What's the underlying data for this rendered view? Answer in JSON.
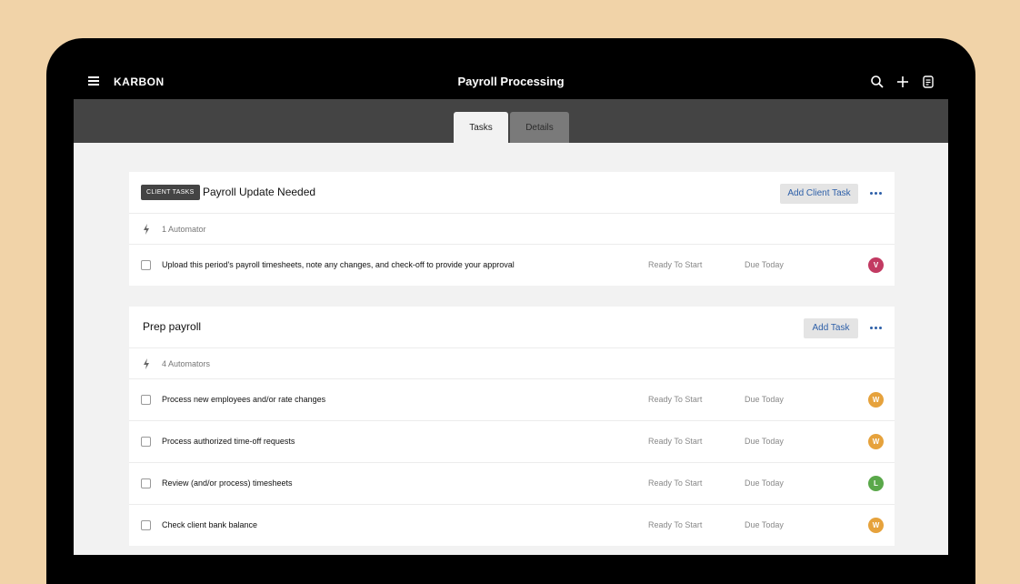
{
  "app": {
    "brand": "KARBON",
    "title": "Payroll Processing"
  },
  "tabs": [
    {
      "label": "Tasks",
      "active": true
    },
    {
      "label": "Details",
      "active": false
    }
  ],
  "icons": {
    "menu": "hamburger-menu-icon",
    "search": "search-icon",
    "add": "plus-icon",
    "notes": "notes-icon",
    "automator": "lightning-bolt-icon",
    "more": "more-dots-icon"
  },
  "colors": {
    "accent": "#2d5fa8",
    "avatar_v": "#c23a62",
    "avatar_w": "#e6a23c",
    "avatar_l": "#5aa84a"
  },
  "client_section": {
    "badge": "CLIENT TASKS",
    "title": "Payroll Update Needed",
    "add_label": "Add Client Task",
    "automators": "1 Automator",
    "tasks": [
      {
        "text": "Upload this period's payroll timesheets, note any changes, and check-off to provide your approval",
        "status": "Ready To Start",
        "due": "Due Today",
        "assignee": "V"
      }
    ]
  },
  "prep_section": {
    "title": "Prep payroll",
    "add_label": "Add Task",
    "automators": "4 Automators",
    "tasks": [
      {
        "text": "Process new employees and/or rate changes",
        "status": "Ready To Start",
        "due": "Due Today",
        "assignee": "W"
      },
      {
        "text": "Process authorized time-off requests",
        "status": "Ready To Start",
        "due": "Due Today",
        "assignee": "W"
      },
      {
        "text": "Review (and/or process) timesheets",
        "status": "Ready To Start",
        "due": "Due Today",
        "assignee": "L"
      },
      {
        "text": "Check client bank balance",
        "status": "Ready To Start",
        "due": "Due Today",
        "assignee": "W"
      }
    ]
  }
}
